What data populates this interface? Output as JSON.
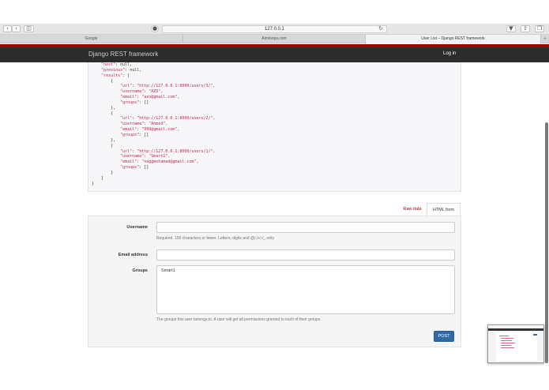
{
  "browser": {
    "url": "127.0.0.1",
    "tabs": [
      {
        "label": "Google",
        "active": false
      },
      {
        "label": "Aimloops.com",
        "active": false
      },
      {
        "label": "User List – Django REST framework",
        "active": true
      }
    ]
  },
  "navbar": {
    "brand": "Django REST framework",
    "login": "Log in",
    "accent_color": "#a30000"
  },
  "response": {
    "lines": [
      {
        "indent": 1,
        "key": "\"next\"",
        "value": "null,"
      },
      {
        "indent": 1,
        "key": "\"previous\"",
        "value": "null,"
      },
      {
        "indent": 1,
        "key": "\"results\"",
        "value": "["
      },
      {
        "indent": 2,
        "key": "",
        "value": "{"
      },
      {
        "indent": 3,
        "key": "\"url\"",
        "value": "\"http://127.0.0.1:8000/users/3/\","
      },
      {
        "indent": 3,
        "key": "\"username\"",
        "value": "\"AZO\","
      },
      {
        "indent": 3,
        "key": "\"email\"",
        "value": "\"azo@gmail.com\","
      },
      {
        "indent": 3,
        "key": "\"groups\"",
        "value": "[]"
      },
      {
        "indent": 2,
        "key": "",
        "value": "},"
      },
      {
        "indent": 2,
        "key": "",
        "value": "{"
      },
      {
        "indent": 3,
        "key": "\"url\"",
        "value": "\"http://127.0.0.1:8000/users/2/\","
      },
      {
        "indent": 3,
        "key": "\"username\"",
        "value": "\"Ahmed\","
      },
      {
        "indent": 3,
        "key": "\"email\"",
        "value": "\"999@gmail.com\","
      },
      {
        "indent": 3,
        "key": "\"groups\"",
        "value": "[]"
      },
      {
        "indent": 2,
        "key": "",
        "value": "},"
      },
      {
        "indent": 2,
        "key": "",
        "value": "{"
      },
      {
        "indent": 3,
        "key": "\"url\"",
        "value": "\"http://127.0.0.1:8000/users/1/\","
      },
      {
        "indent": 3,
        "key": "\"username\"",
        "value": "\"Smart1\","
      },
      {
        "indent": 3,
        "key": "\"email\"",
        "value": "\"naggmohamad@gmail.com\","
      },
      {
        "indent": 3,
        "key": "\"groups\"",
        "value": "[]"
      },
      {
        "indent": 2,
        "key": "",
        "value": "}"
      },
      {
        "indent": 1,
        "key": "",
        "value": "]"
      },
      {
        "indent": 0,
        "key": "",
        "value": "}"
      }
    ]
  },
  "form_tabs": {
    "raw": "Raw data",
    "html": "HTML form"
  },
  "form": {
    "username_label": "Username",
    "username_value": "",
    "username_help": "Required. 150 characters or fewer. Letters, digits and @/./+/-/_ only.",
    "email_label": "Email address",
    "email_value": "",
    "groups_label": "Groups",
    "groups_options": [
      "Smart1"
    ],
    "groups_help": "The groups this user belongs to. A user will get all permissions granted to each of their groups.",
    "submit": "POST"
  }
}
